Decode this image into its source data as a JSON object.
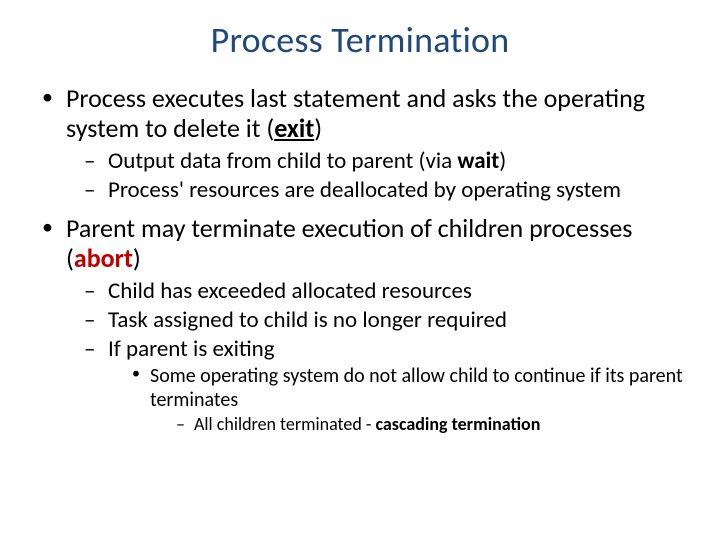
{
  "title": "Process Termination",
  "b1": {
    "pre": "Process executes last statement and asks the operating system to delete it (",
    "kw": "exit",
    "post": ")",
    "s1": {
      "pre": "Output data from child to parent (via ",
      "kw": "wait",
      "post": ")"
    },
    "s2": "Process' resources are deallocated by operating system"
  },
  "b2": {
    "pre": "Parent may terminate execution of children processes (",
    "kw": "abort",
    "post": ")",
    "s1": "Child has exceeded allocated resources",
    "s2": "Task assigned to child is no longer required",
    "s3": "If parent is exiting",
    "s3a": "Some operating system do not allow child to continue if its parent terminates",
    "s3a1": {
      "pre": "All children terminated - ",
      "kw": "cascading termination"
    }
  }
}
